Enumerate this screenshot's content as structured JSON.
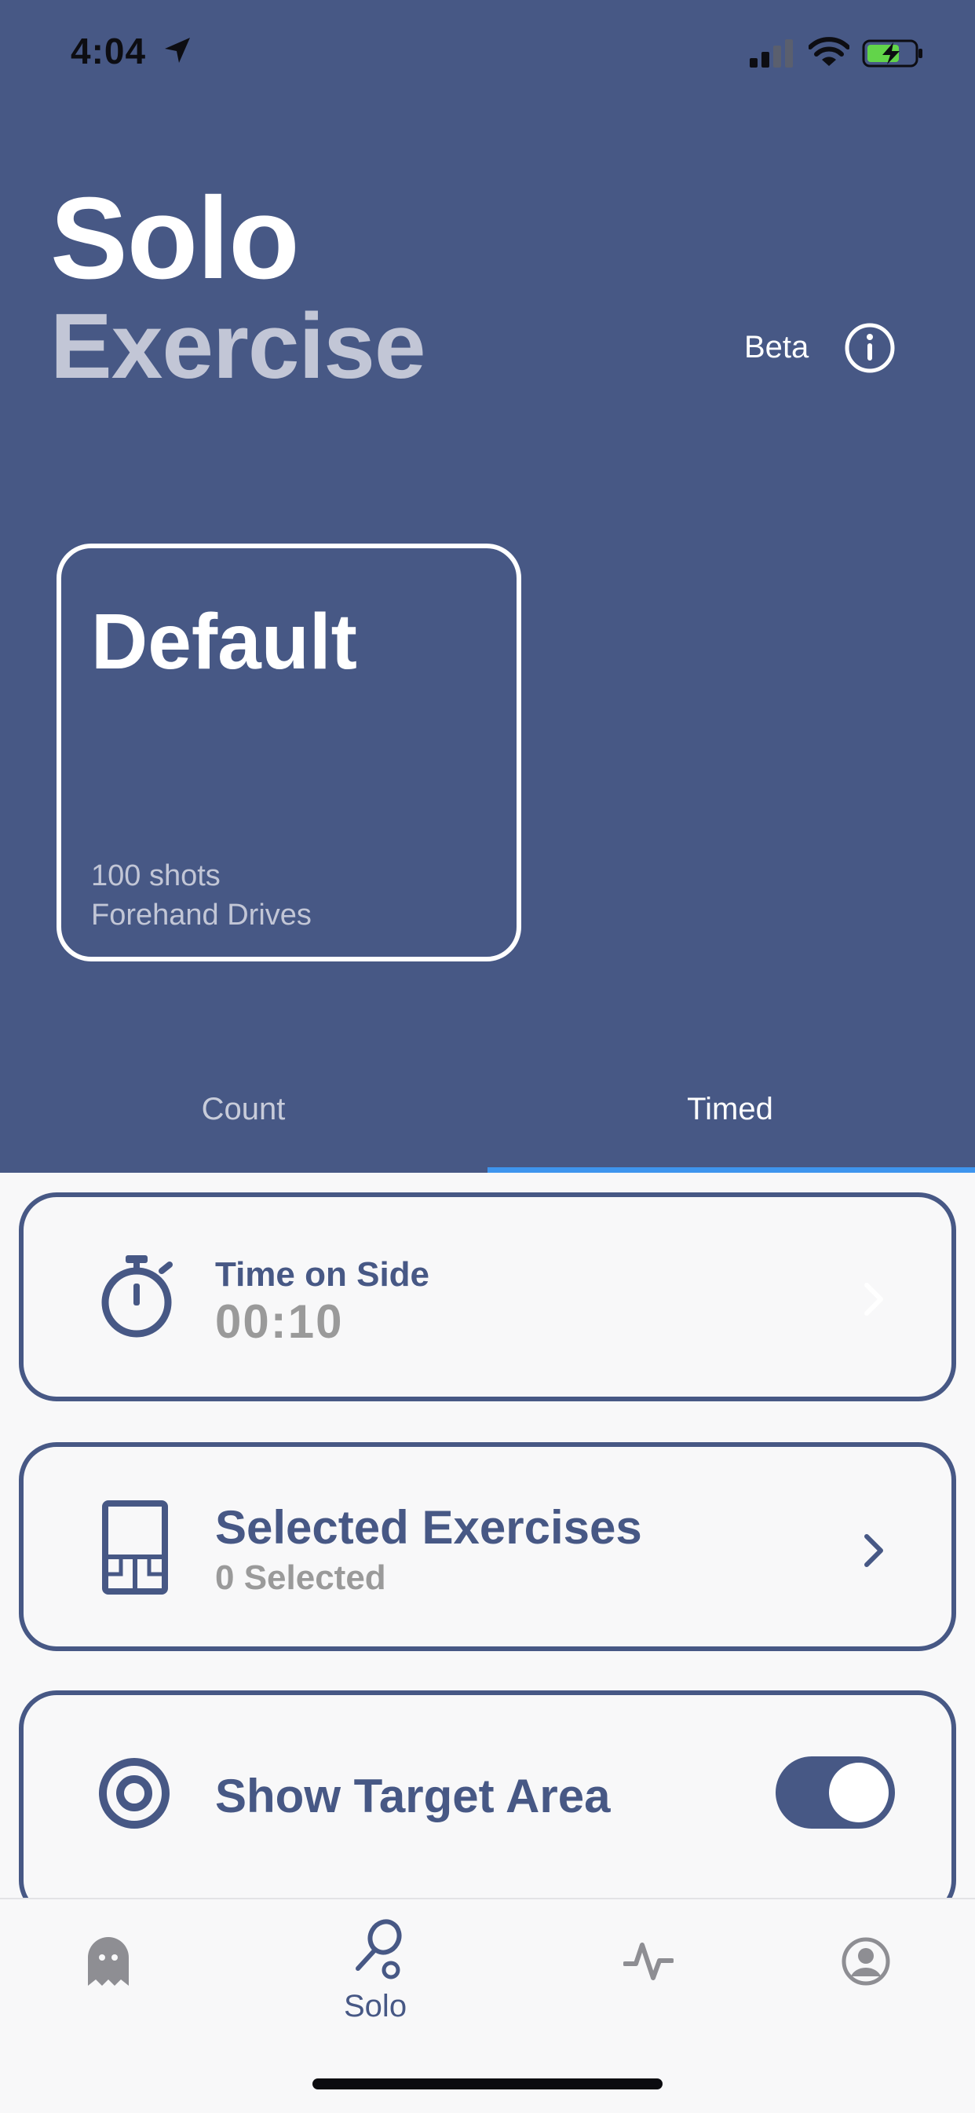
{
  "status_bar": {
    "time": "4:04"
  },
  "header": {
    "title_line1": "Solo",
    "title_line2": "Exercise",
    "beta_label": "Beta"
  },
  "preset": {
    "name": "Default",
    "shots": "100 shots",
    "type": "Forehand Drives"
  },
  "tabs": [
    {
      "label": "Count",
      "selected": false
    },
    {
      "label": "Timed",
      "selected": true
    }
  ],
  "settings": {
    "time_on_side": {
      "title": "Time on Side",
      "value": "00:10",
      "icon": "stopwatch-icon"
    },
    "selected_exercises": {
      "title": "Selected Exercises",
      "value": "0 Selected",
      "icon": "exercises-grid-icon"
    },
    "show_target_area": {
      "title": "Show Target Area",
      "enabled": true,
      "icon": "target-icon"
    }
  },
  "tab_bar": {
    "items": [
      {
        "icon": "ghost-icon",
        "label": ""
      },
      {
        "icon": "racket-icon",
        "label": "Solo",
        "selected": true
      },
      {
        "icon": "activity-icon",
        "label": ""
      },
      {
        "icon": "profile-icon",
        "label": ""
      }
    ]
  },
  "colors": {
    "primary": "#475885",
    "accent": "#3E95EE",
    "muted_text": "#C2C6D6",
    "gray_value": "#9A9A9A"
  }
}
